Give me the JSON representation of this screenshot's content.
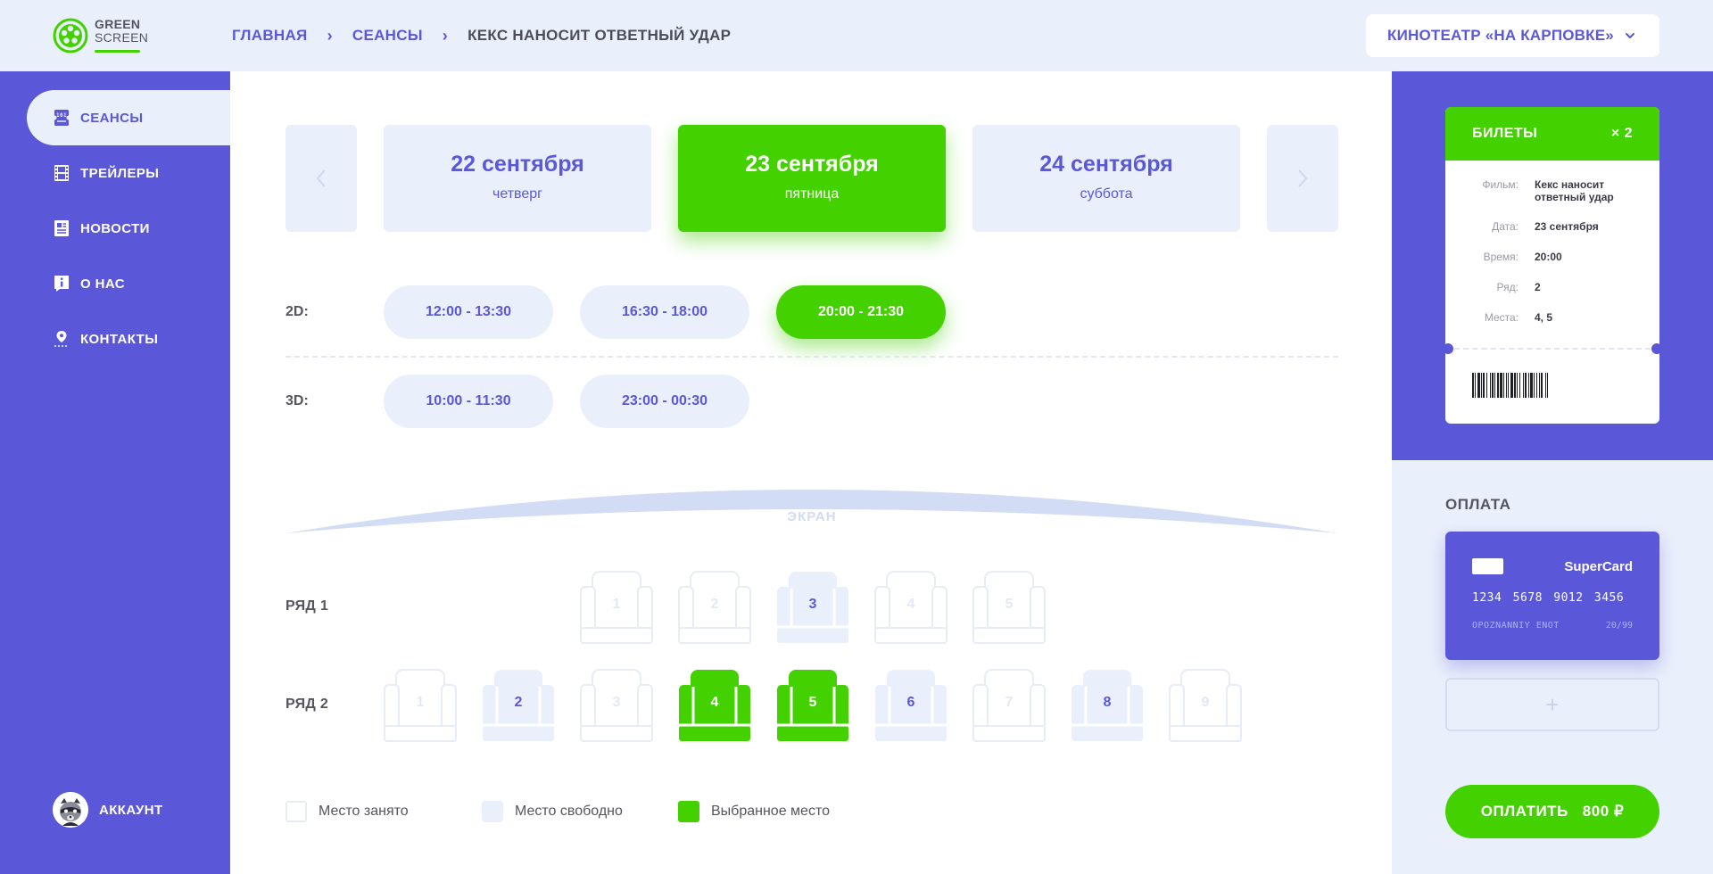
{
  "logo": {
    "line1": "GREEN",
    "line2": "SCREEN"
  },
  "breadcrumb": {
    "home": "ГЛАВНАЯ",
    "sessions": "СЕАНСЫ",
    "current": "КЕКС НАНОСИТ ОТВЕТНЫЙ УДАР",
    "separator": "›"
  },
  "cinema": {
    "selected": "КИНОТЕАТР «НА КАРПОВКЕ»",
    "icon": "chevron-down-icon"
  },
  "sidebar": {
    "items": [
      {
        "label": "СЕАНСЫ",
        "icon": "ticket-icon",
        "active": true
      },
      {
        "label": "ТРЕЙЛЕРЫ",
        "icon": "film-icon",
        "active": false
      },
      {
        "label": "НОВОСТИ",
        "icon": "newspaper-icon",
        "active": false
      },
      {
        "label": "О НАС",
        "icon": "info-icon",
        "active": false
      },
      {
        "label": "КОНТАКТЫ",
        "icon": "location-pin-icon",
        "active": false
      }
    ],
    "account": {
      "label": "АККАУНТ",
      "icon": "raccoon-avatar"
    }
  },
  "dates": [
    {
      "date": "22 сентября",
      "weekday": "четверг",
      "active": false
    },
    {
      "date": "23 сентября",
      "weekday": "пятница",
      "active": true
    },
    {
      "date": "24 сентября",
      "weekday": "суббота",
      "active": false
    }
  ],
  "sessions": [
    {
      "format": "2D:",
      "times": [
        "12:00 - 13:30",
        "16:30 - 18:00",
        "20:00 - 21:30"
      ],
      "active_index": 2
    },
    {
      "format": "3D:",
      "times": [
        "10:00 - 11:30",
        "23:00 - 00:30"
      ],
      "active_index": -1
    }
  ],
  "screen_label": "ЭКРАН",
  "seating": {
    "rows": [
      {
        "label": "РЯД 1",
        "seats": [
          {
            "num": "1",
            "status": "taken"
          },
          {
            "num": "2",
            "status": "taken"
          },
          {
            "num": "3",
            "status": "free"
          },
          {
            "num": "4",
            "status": "taken"
          },
          {
            "num": "5",
            "status": "taken"
          }
        ]
      },
      {
        "label": "РЯД 2",
        "seats": [
          {
            "num": "1",
            "status": "taken"
          },
          {
            "num": "2",
            "status": "free"
          },
          {
            "num": "3",
            "status": "taken"
          },
          {
            "num": "4",
            "status": "selected"
          },
          {
            "num": "5",
            "status": "selected"
          },
          {
            "num": "6",
            "status": "free"
          },
          {
            "num": "7",
            "status": "taken"
          },
          {
            "num": "8",
            "status": "free"
          },
          {
            "num": "9",
            "status": "taken"
          }
        ]
      }
    ]
  },
  "legend": {
    "taken": "Место занято",
    "free": "Место свободно",
    "selected": "Выбранное место"
  },
  "ticket": {
    "title": "БИЛЕТЫ",
    "count": "× 2",
    "rows": [
      {
        "key": "Фильм:",
        "value": "Кекс наносит ответный удар"
      },
      {
        "key": "Дата:",
        "value": "23 сентября"
      },
      {
        "key": "Время:",
        "value": "20:00"
      },
      {
        "key": "Ряд:",
        "value": "2"
      },
      {
        "key": "Места:",
        "value": "4, 5"
      }
    ]
  },
  "payment": {
    "title": "ОПЛАТА",
    "card": {
      "brand": "SuperCard",
      "number": "1234 5678 9012 3456",
      "holder": "OPOZNANNIY ENOT",
      "expiry": "20/99"
    },
    "add_card": "+",
    "pay_label": "ОПЛАТИТЬ",
    "amount": "800 ₽"
  },
  "colors": {
    "accent": "#5b57d9",
    "green": "#43d100",
    "light": "#eaf0fb"
  }
}
